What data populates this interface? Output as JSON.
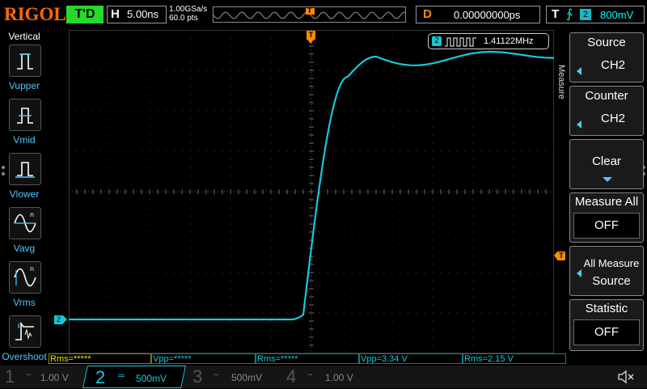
{
  "brand": "RIGOL",
  "status": "T'D",
  "horizontal": {
    "label": "H",
    "timebase": "5.00ns"
  },
  "sample": {
    "rate": "1.00GSa/s",
    "points": "60.0 pts"
  },
  "memory": {
    "trigger_marker": "T"
  },
  "delay": {
    "label": "D",
    "value": "0.00000000ps"
  },
  "trigger": {
    "label": "T",
    "edge_symbol": "∱",
    "channel": "2",
    "level": "800mV"
  },
  "left_menu": {
    "title": "Vertical",
    "items": [
      {
        "label": "Vupper",
        "icon": "vupper-icon"
      },
      {
        "label": "Vmid",
        "icon": "vmid-icon"
      },
      {
        "label": "Vlower",
        "icon": "vlower-icon"
      },
      {
        "label": "Vavg",
        "icon": "vavg-icon"
      },
      {
        "label": "Vrms",
        "icon": "vrms-icon"
      },
      {
        "label": "Overshoot",
        "icon": "overshoot-icon"
      }
    ]
  },
  "screen": {
    "trigger_marker": "T",
    "channel_marker": "2",
    "counter_channel": "2",
    "counter_value": "1.41122MHz"
  },
  "right_menu": {
    "side_label": "Measure",
    "source": {
      "title": "Source",
      "value": "CH2"
    },
    "counter": {
      "title": "Counter",
      "value": "CH2"
    },
    "clear": {
      "title": "Clear"
    },
    "measure_all": {
      "title": "Measure All",
      "value": "OFF"
    },
    "all_measure_source": {
      "line1": "All Measure",
      "line2": "Source"
    },
    "statistic": {
      "title": "Statistic",
      "value": "OFF"
    }
  },
  "measurements": [
    {
      "text": "Rms=*****",
      "color": "#e8e800"
    },
    {
      "text": "Vpp=*****",
      "color": "#18c8d8"
    },
    {
      "text": "Rms=*****",
      "color": "#18c8d8"
    },
    {
      "text": "Vpp=3.34 V",
      "color": "#18c8d8"
    },
    {
      "text": "Rms=2.15 V",
      "color": "#18c8d8"
    }
  ],
  "channels": [
    {
      "num": "1",
      "coupling": "~",
      "scale": "1.00 V",
      "active": false
    },
    {
      "num": "2",
      "coupling": "═",
      "scale": "500mV",
      "active": true
    },
    {
      "num": "3",
      "coupling": "~",
      "scale": "500mV",
      "active": false
    },
    {
      "num": "4",
      "coupling": "~",
      "scale": "1.00 V",
      "active": false
    }
  ],
  "colors": {
    "ch2": "#18c8d8",
    "ch1": "#e8e800",
    "trigger": "#ff8a00",
    "accent": "#4fc8ff"
  }
}
